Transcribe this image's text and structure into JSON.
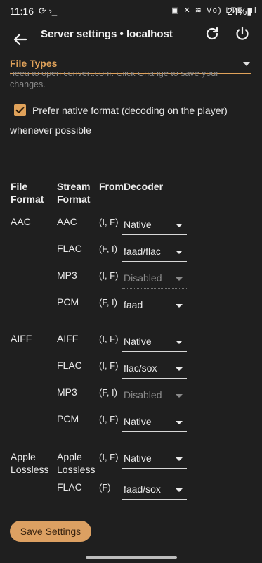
{
  "statusbar": {
    "time": "11:16",
    "left_icons": "⟳ ›_",
    "right_icons": "▣ ✕ ≋ Vo) LTE .ıl",
    "battery": "24%▮"
  },
  "appbar": {
    "title": "Server settings • localhost"
  },
  "file_types": {
    "label": "File Types"
  },
  "note": {
    "line1": "need to open convert.conf. Click Change to save your",
    "line2": "changes."
  },
  "prefer_native": {
    "checked": true,
    "label_line1": "Prefer native format (decoding on the player)",
    "label_line2": "whenever possible"
  },
  "table": {
    "headers": {
      "file_format": [
        "File",
        "Format"
      ],
      "stream_format": [
        "Stream",
        "Format"
      ],
      "from": "From",
      "decoder": "Decoder"
    },
    "rows": [
      {
        "file": "AAC",
        "stream": "AAC",
        "from": "(I, F)",
        "decoder": "Native",
        "disabled": false
      },
      {
        "file": "",
        "stream": "FLAC",
        "from": "(F, I)",
        "decoder": "faad/flac",
        "disabled": false
      },
      {
        "file": "",
        "stream": "MP3",
        "from": "(I, F)",
        "decoder": "Disabled",
        "disabled": true
      },
      {
        "file": "",
        "stream": "PCM",
        "from": "(F, I)",
        "decoder": "faad",
        "disabled": false
      },
      {
        "file": "AIFF",
        "stream": "AIFF",
        "from": "(I, F)",
        "decoder": "Native",
        "disabled": false
      },
      {
        "file": "",
        "stream": "FLAC",
        "from": "(I, F)",
        "decoder": "flac/sox",
        "disabled": false
      },
      {
        "file": "",
        "stream": "MP3",
        "from": "(F, I)",
        "decoder": "Disabled",
        "disabled": true
      },
      {
        "file": "",
        "stream": "PCM",
        "from": "(I, F)",
        "decoder": "Native",
        "disabled": false
      },
      {
        "file": [
          "Apple",
          "Lossless"
        ],
        "stream": [
          "Apple",
          "Lossless"
        ],
        "from": "(I, F)",
        "decoder": "Native",
        "disabled": false
      },
      {
        "file": "",
        "stream": "FLAC",
        "from": "(F)",
        "decoder": "faad/sox",
        "disabled": false
      }
    ]
  },
  "save_button": {
    "label": "Save Settings"
  },
  "colors": {
    "accent": "#e0a25a",
    "background": "#1f1f1f",
    "button": "#dca062"
  }
}
